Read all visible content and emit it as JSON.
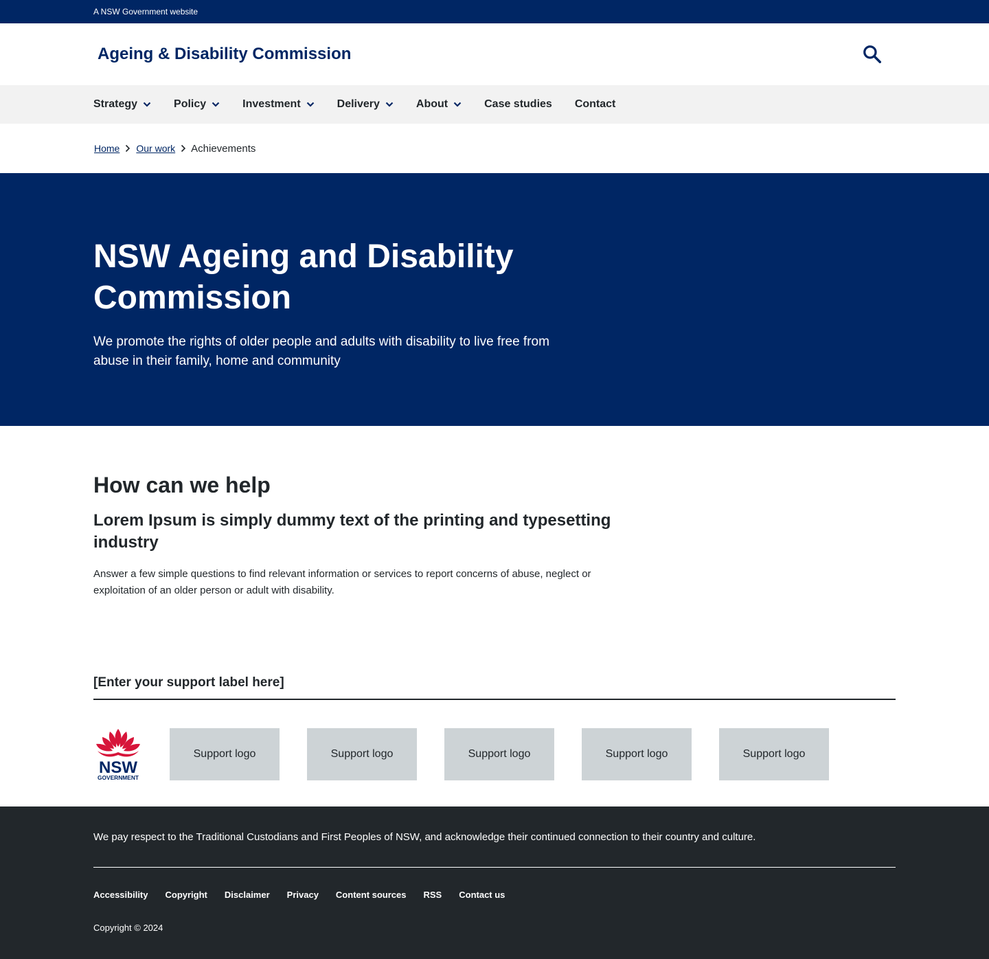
{
  "topbar": {
    "text": "A NSW Government website"
  },
  "header": {
    "site_title": "Ageing & Disability Commission",
    "search_icon": "search-icon"
  },
  "nav": {
    "items": [
      {
        "label": "Strategy",
        "has_dropdown": true
      },
      {
        "label": "Policy",
        "has_dropdown": true
      },
      {
        "label": "Investment",
        "has_dropdown": true
      },
      {
        "label": "Delivery",
        "has_dropdown": true
      },
      {
        "label": "About",
        "has_dropdown": true
      },
      {
        "label": "Case studies",
        "has_dropdown": false
      },
      {
        "label": "Contact",
        "has_dropdown": false
      }
    ]
  },
  "breadcrumb": {
    "items": [
      "Home",
      "Our work"
    ],
    "current": "Achievements"
  },
  "hero": {
    "title": "NSW Ageing and Disability Commission",
    "intro": "We promote the rights of older people and adults with disability to live free from abuse in their family, home and community"
  },
  "help": {
    "heading": "How can we help",
    "subheading": "Lorem Ipsum is simply dummy text of the printing and typesetting industry",
    "body": "Answer a few simple questions to find relevant information or services to report concerns of abuse, neglect or exploitation of an older person or adult with disability."
  },
  "support": {
    "label": "[Enter your support label here]",
    "nsw_logo_text": "NSW",
    "nsw_logo_subtext": "GOVERNMENT",
    "logos": [
      "Support logo",
      "Support logo",
      "Support logo",
      "Support logo",
      "Support logo"
    ]
  },
  "footer": {
    "acknowledgement": "We pay respect to the Traditional Custodians and First Peoples of NSW, and acknowledge their continued connection to their country and culture.",
    "links": [
      "Accessibility",
      "Copyright",
      "Disclaimer",
      "Privacy",
      "Content sources",
      "RSS",
      "Contact us"
    ],
    "copyright": "Copyright © 2024"
  },
  "colors": {
    "brand_navy": "#002664",
    "nav_bg": "#f2f2f2",
    "footer_bg": "#22272b",
    "logo_placeholder": "#cdd3d6",
    "waratah_red": "#d7153a"
  }
}
